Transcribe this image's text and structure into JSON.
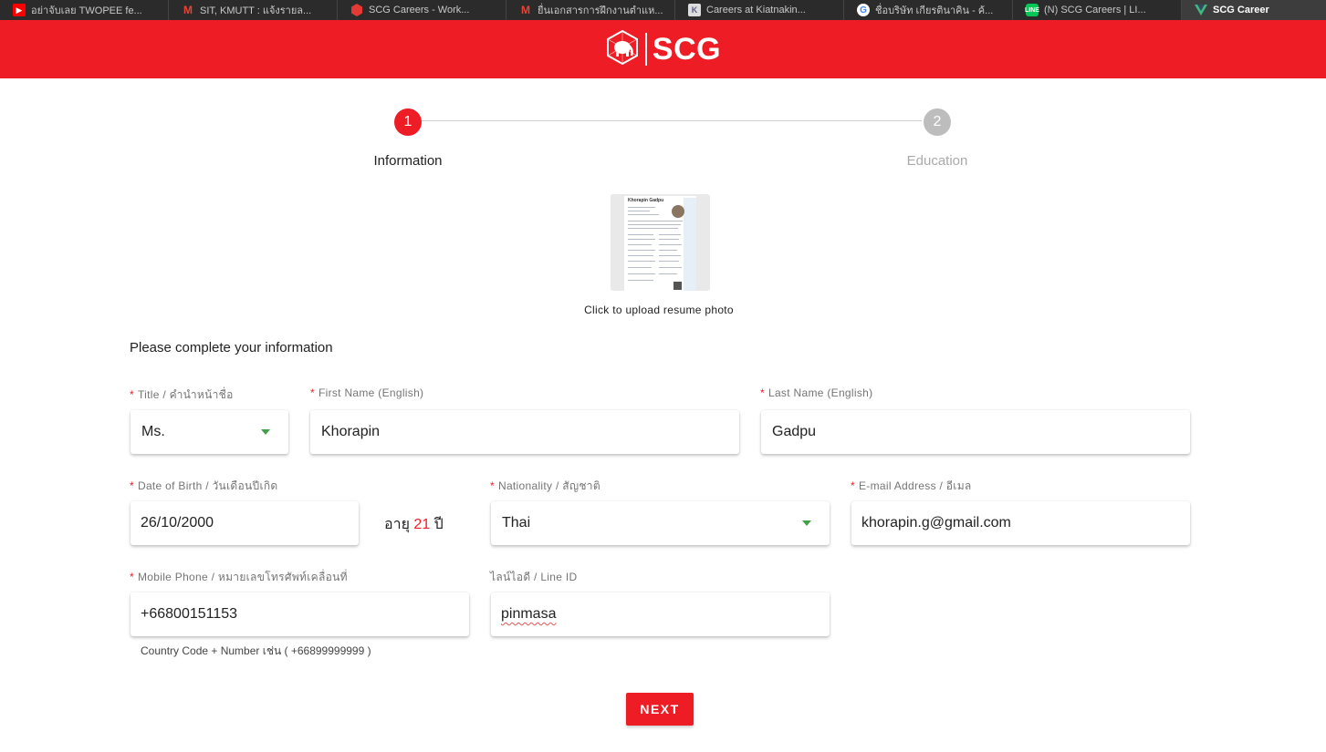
{
  "browser": {
    "tabs": [
      {
        "label": "อย่าจับเลย TWOPEE fe...",
        "icon": "youtube-icon",
        "color": "#ff0000"
      },
      {
        "label": "SIT, KMUTT : แจ้งรายล...",
        "icon": "gmail-icon",
        "color": "#ea4335"
      },
      {
        "label": "SCG Careers - Work...",
        "icon": "scg-hex-icon",
        "color": "#e53935"
      },
      {
        "label": "ยื่นเอกสารการฝึกงานตำแห...",
        "icon": "gmail-icon",
        "color": "#ea4335"
      },
      {
        "label": "Careers at Kiatnakin...",
        "icon": "kiatnakin-icon",
        "color": "#5b5b8a"
      },
      {
        "label": "ชื่อบริษัท เกียรตินาคิน - ค้...",
        "icon": "google-icon",
        "color": "#4285f4"
      },
      {
        "label": "(N) SCG Careers | LI...",
        "icon": "line-icon",
        "color": "#06c755"
      },
      {
        "label": "SCG Career",
        "icon": "vue-icon",
        "color": "#41b883"
      }
    ]
  },
  "header": {
    "logo_text": "SCG"
  },
  "stepper": {
    "steps": [
      {
        "number": "1",
        "label": "Information"
      },
      {
        "number": "2",
        "label": "Education"
      }
    ]
  },
  "upload": {
    "caption": "Click to upload resume photo",
    "resume_name": "Khorapin Gadpu"
  },
  "form": {
    "title": "Please complete your information",
    "required_mark": "*",
    "title_field": {
      "label": "Title / คำนำหน้าชื่อ",
      "value": "Ms."
    },
    "first_name": {
      "label": "First Name (English)",
      "value": "Khorapin"
    },
    "last_name": {
      "label": "Last Name (English)",
      "value": "Gadpu"
    },
    "dob": {
      "label": "Date of Birth / วันเดือนปีเกิด",
      "value": "26/10/2000"
    },
    "age": {
      "prefix": "อายุ",
      "value": "21",
      "suffix": "ปี"
    },
    "nationality": {
      "label": "Nationality / สัญชาติ",
      "value": "Thai"
    },
    "email": {
      "label": "E-mail Address / อีเมล",
      "value": "khorapin.g@gmail.com"
    },
    "mobile": {
      "label": "Mobile Phone / หมายเลขโทรศัพท์เคลื่อนที่",
      "value": "+66800151153",
      "hint": "Country Code + Number เช่น ( +66899999999 )"
    },
    "line_id": {
      "label": "ไลน์ไอดี / Line ID",
      "value": "pinmasa"
    }
  },
  "actions": {
    "next_label": "NEXT"
  },
  "colors": {
    "brand_red": "#ee1c25",
    "select_caret": "#43a047",
    "inactive_step": "#bdbdbd"
  }
}
